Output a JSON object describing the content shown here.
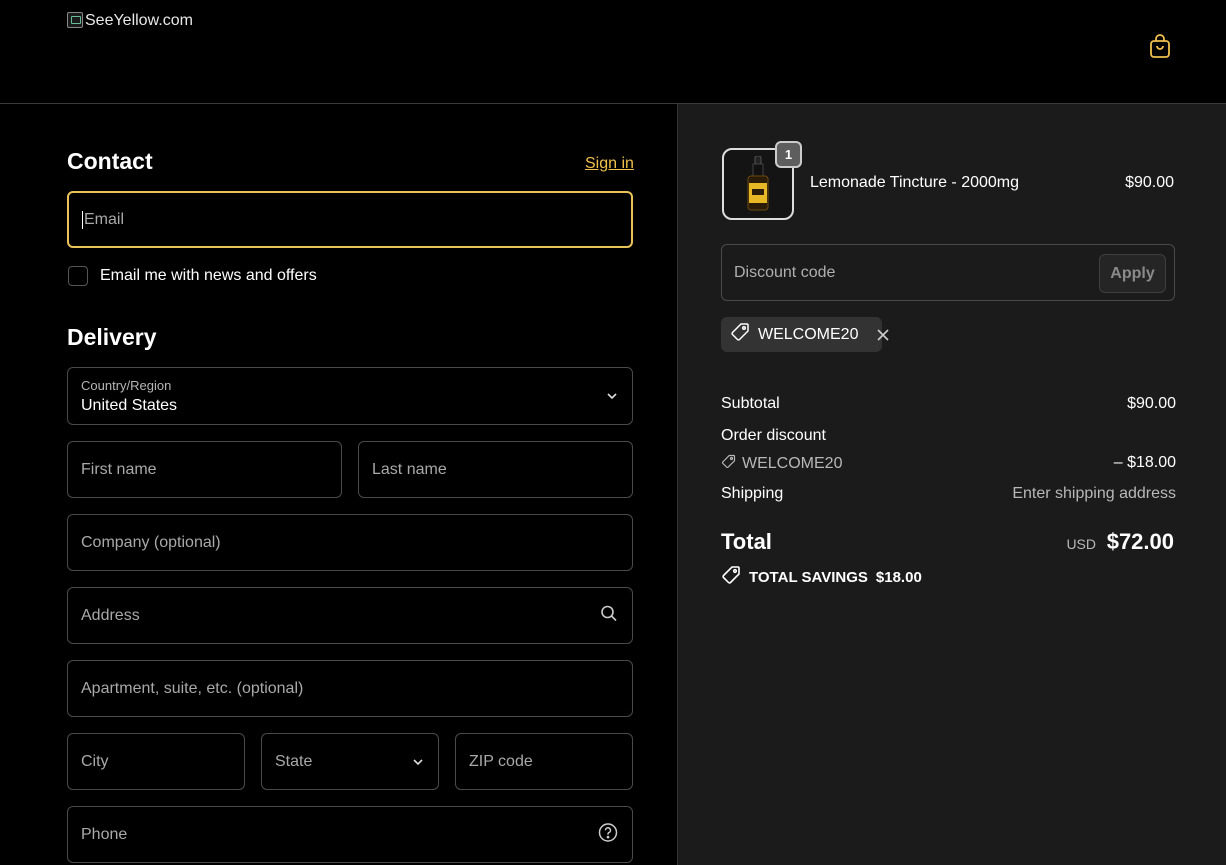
{
  "header": {
    "logo_alt": "SeeYellow.com"
  },
  "contact": {
    "title": "Contact",
    "sign_in": "Sign in",
    "email_placeholder": "Email",
    "newsletter_label": "Email me with news and offers"
  },
  "delivery": {
    "title": "Delivery",
    "country_label": "Country/Region",
    "country_value": "United States",
    "first_name": "First name",
    "last_name": "Last name",
    "company": "Company (optional)",
    "address": "Address",
    "apartment": "Apartment, suite, etc. (optional)",
    "city": "City",
    "state": "State",
    "zip": "ZIP code",
    "phone": "Phone"
  },
  "summary": {
    "product": {
      "name": "Lemonade Tincture - 2000mg",
      "price": "$90.00",
      "quantity": "1"
    },
    "discount_placeholder": "Discount code",
    "apply": "Apply",
    "applied_code": "WELCOME20",
    "subtotal_label": "Subtotal",
    "subtotal_value": "$90.00",
    "order_discount_label": "Order discount",
    "order_discount_code": "WELCOME20",
    "order_discount_value": "– $18.00",
    "shipping_label": "Shipping",
    "shipping_value": "Enter shipping address",
    "total_label": "Total",
    "total_currency": "USD",
    "total_value": "$72.00",
    "savings_label": "TOTAL SAVINGS",
    "savings_value": "$18.00"
  },
  "colors": {
    "accent": "#f0c14b",
    "focus_border": "#e9c25a",
    "panel_bg": "#1b1b1b"
  }
}
